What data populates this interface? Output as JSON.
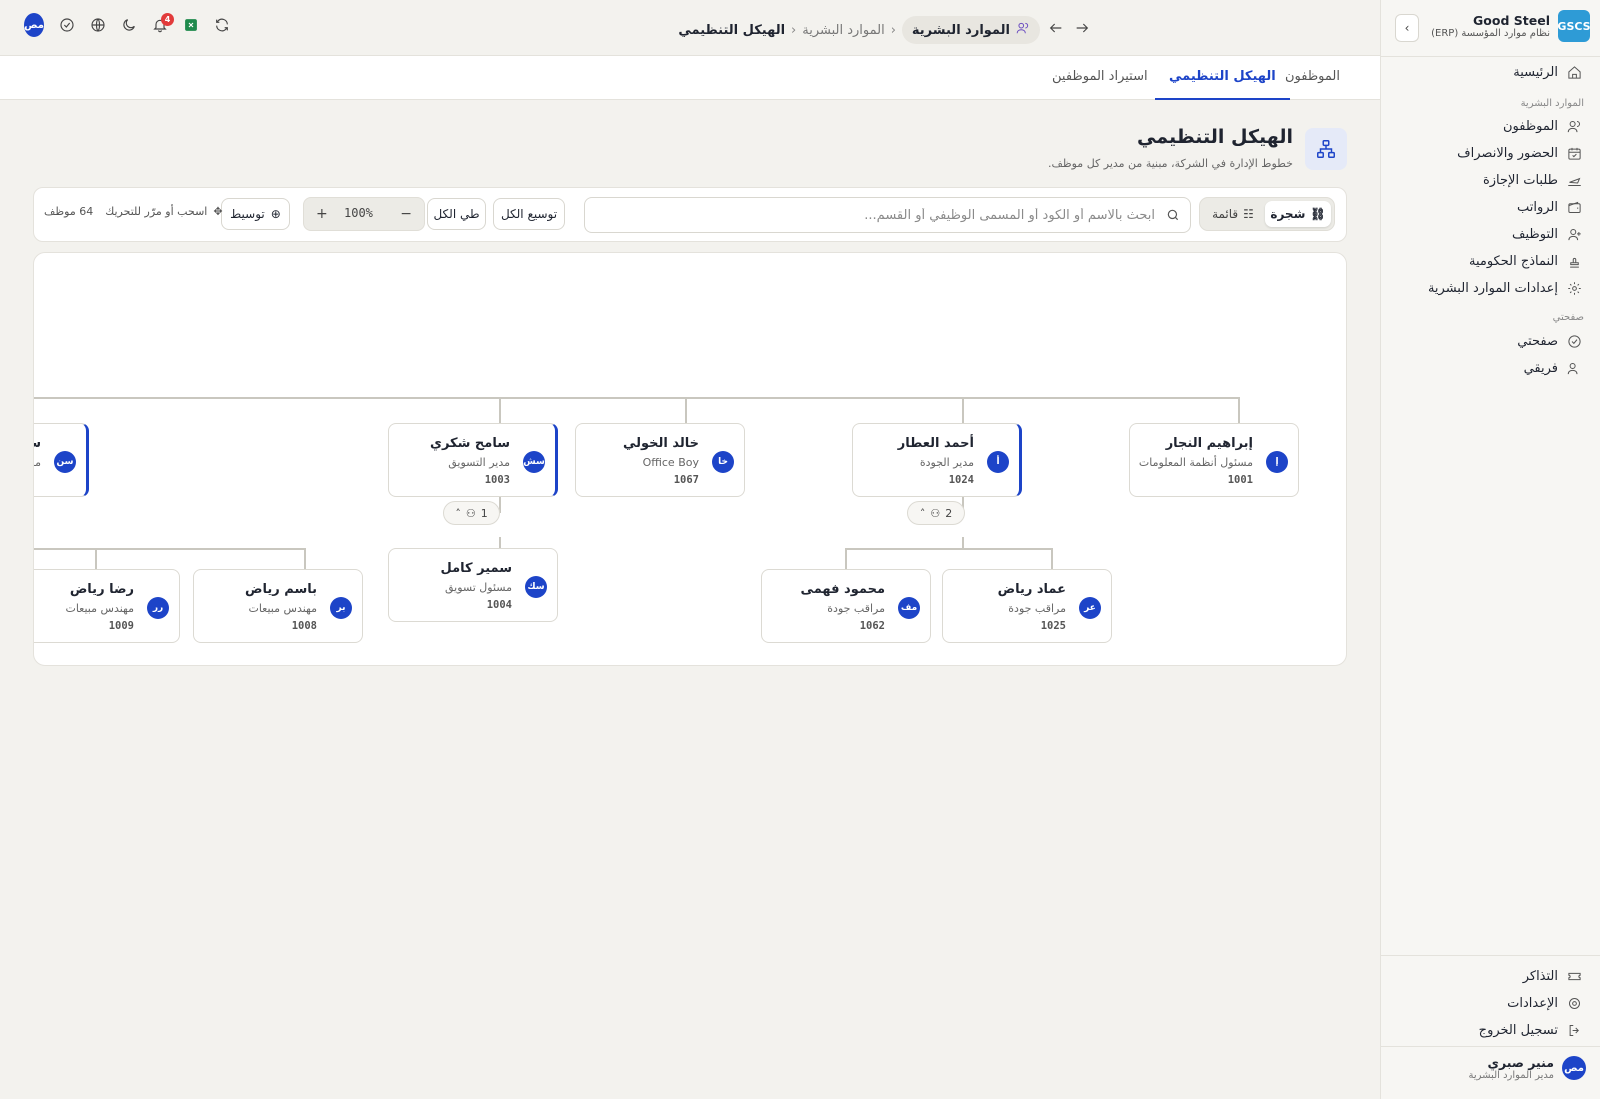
{
  "brand": {
    "logo": "GSCS",
    "name": "Good Steel",
    "subtitle": "نظام موارد المؤسسة (ERP)"
  },
  "sidebar": {
    "home": "الرئيسية",
    "section_hr": "الموارد البشرية",
    "items": [
      "الموظفون",
      "الحضور والانصراف",
      "طلبات الإجازة",
      "الرواتب",
      "التوظيف",
      "النماذج الحكومية",
      "إعدادات الموارد البشرية"
    ],
    "section_mine": "صفحتي",
    "mine_items": [
      "صفحتي",
      "فريقي"
    ],
    "bottom": [
      "التذاكر",
      "الإعدادات",
      "تسجيل الخروج"
    ],
    "user": {
      "initials": "مص",
      "name": "منير صبري",
      "role": "مدير الموارد البشرية"
    }
  },
  "topbar": {
    "notifications_count": "4",
    "avatar": "مص",
    "breadcrumb": {
      "module": "الموارد البشرية",
      "parent": "الموارد البشرية",
      "current": "الهيكل التنظيمي"
    }
  },
  "tabs": [
    "الموظفون",
    "الهيكل التنظيمي",
    "استيراد الموظفين"
  ],
  "page": {
    "title": "الهيكل التنظيمي",
    "subtitle": "خطوط الإدارة في الشركة، مبنية من مدير كل موظف."
  },
  "toolbar": {
    "view_tree": "شجرة",
    "view_list": "قائمة",
    "search_placeholder": "ابحث بالاسم أو الكود أو المسمى الوظيفي أو القسم...",
    "expand_all": "توسيع الكل",
    "collapse_all": "طي الكل",
    "zoom": "100%",
    "zoom_in": "+",
    "zoom_out": "−",
    "center": "توسيط",
    "drag_hint": "اسحب أو مرّر للتحريك",
    "count": "64 موظف"
  },
  "org": {
    "top": [
      {
        "initials": "إ",
        "name": "إبراهيم النجار",
        "role": "مسئول أنظمة المعلومات",
        "code": "1001"
      },
      {
        "initials": "أ",
        "name": "أحمد العطار",
        "role": "مدير الجودة",
        "code": "1024"
      },
      {
        "initials": "خا",
        "name": "خالد الخولي",
        "role": "Office Boy",
        "code": "1067"
      },
      {
        "initials": "سش",
        "name": "سامح شكري",
        "role": "مدير التسويق",
        "code": "1003"
      },
      {
        "initials": "سن",
        "name": "سا",
        "role": "مد",
        "code": ""
      }
    ],
    "pill_quality": "2",
    "pill_marketing": "1",
    "children": [
      {
        "initials": "عر",
        "name": "عماد رياض",
        "role": "مراقب جودة",
        "code": "1025"
      },
      {
        "initials": "مف",
        "name": "محمود فهمى",
        "role": "مراقب جودة",
        "code": "1062"
      },
      {
        "initials": "سك",
        "name": "سمير كامل",
        "role": "مسئول تسويق",
        "code": "1004"
      },
      {
        "initials": "بر",
        "name": "باسم رياض",
        "role": "مهندس مبيعات",
        "code": "1008"
      },
      {
        "initials": "رر",
        "name": "رضا رياض",
        "role": "مهندس مبيعات",
        "code": "1009"
      }
    ]
  }
}
